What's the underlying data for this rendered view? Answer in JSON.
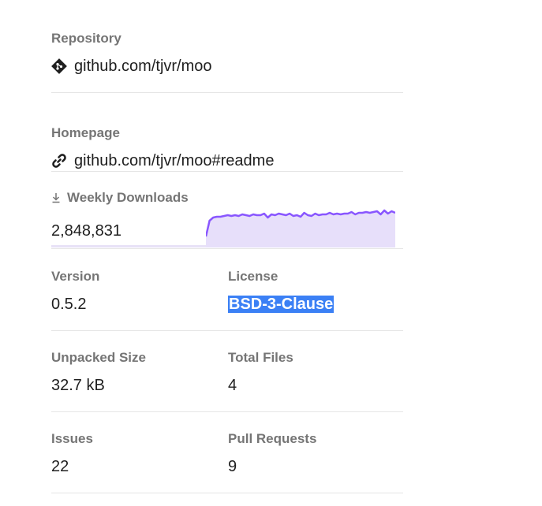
{
  "repository": {
    "label": "Repository",
    "value": "github.com/tjvr/moo",
    "icon": "git-icon"
  },
  "homepage": {
    "label": "Homepage",
    "value": "github.com/tjvr/moo#readme",
    "icon": "link-icon"
  },
  "downloads": {
    "label": "Weekly Downloads",
    "value": "2,848,831",
    "icon": "download-icon",
    "accent_color": "#8956ff",
    "fill_color": "#e7dffa",
    "sparkline": [
      38,
      18,
      14,
      13,
      13,
      12,
      11,
      12,
      11,
      12,
      10,
      11,
      12,
      10,
      11,
      11,
      9,
      14,
      10,
      11,
      9,
      10,
      11,
      9,
      12,
      11,
      13,
      8,
      11,
      12,
      9,
      11,
      10,
      10,
      8,
      10,
      9,
      10,
      9,
      9,
      7,
      10,
      8,
      8,
      7,
      8,
      7,
      6,
      10,
      5,
      9,
      6,
      8
    ]
  },
  "version": {
    "label": "Version",
    "value": "0.5.2"
  },
  "license": {
    "label": "License",
    "value": "BSD-3-Clause"
  },
  "unpacked_size": {
    "label": "Unpacked Size",
    "value": "32.7 kB"
  },
  "total_files": {
    "label": "Total Files",
    "value": "4"
  },
  "issues": {
    "label": "Issues",
    "value": "22"
  },
  "pull_requests": {
    "label": "Pull Requests",
    "value": "9"
  }
}
